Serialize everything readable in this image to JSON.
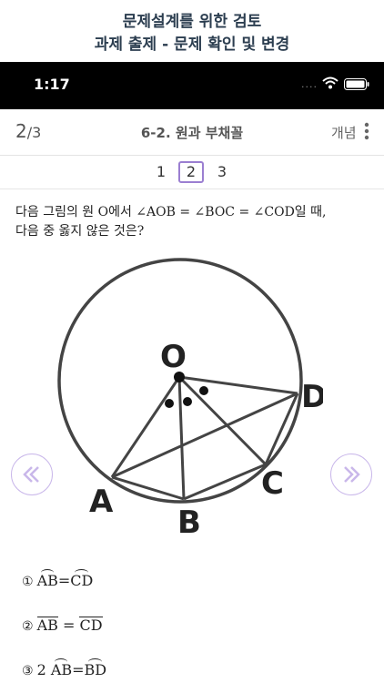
{
  "banner": {
    "line1": "문제설계를 위한 검토",
    "line2": "과제 출제 - 문제 확인 및 변경"
  },
  "status": {
    "time": "1:17",
    "dots": "....",
    "icons": [
      "wifi-icon",
      "battery-icon"
    ]
  },
  "header": {
    "page_current": "2",
    "page_total": "/3",
    "title": "6-2. 원과 부채꼴",
    "concept": "개념"
  },
  "pager": {
    "pages": [
      "1",
      "2",
      "3"
    ],
    "active": "2"
  },
  "question": {
    "line1": "다음 그림의 원 O에서 ∠AOB = ∠BOC = ∠COD일 때,",
    "line2": "다음 중 옳지 않은 것은?"
  },
  "figure": {
    "labels": {
      "O": "O",
      "A": "A",
      "B": "B",
      "C": "C",
      "D": "D"
    }
  },
  "nav": {
    "prev": "«",
    "next": "»"
  },
  "options": [
    {
      "num": "①",
      "a": "AB",
      "op": "=",
      "b": "CD"
    },
    {
      "num": "②",
      "a": "AB",
      "op": " = ",
      "b": "CD"
    },
    {
      "num": "③",
      "coef": "2 ",
      "a": "AB",
      "op": "=",
      "b": "BD"
    }
  ],
  "colors": {
    "banner_text": "#2c3e50",
    "active_page_border": "#9b7fd1",
    "nav_circle": "#c9b7ea",
    "figure_stroke": "#444444"
  }
}
